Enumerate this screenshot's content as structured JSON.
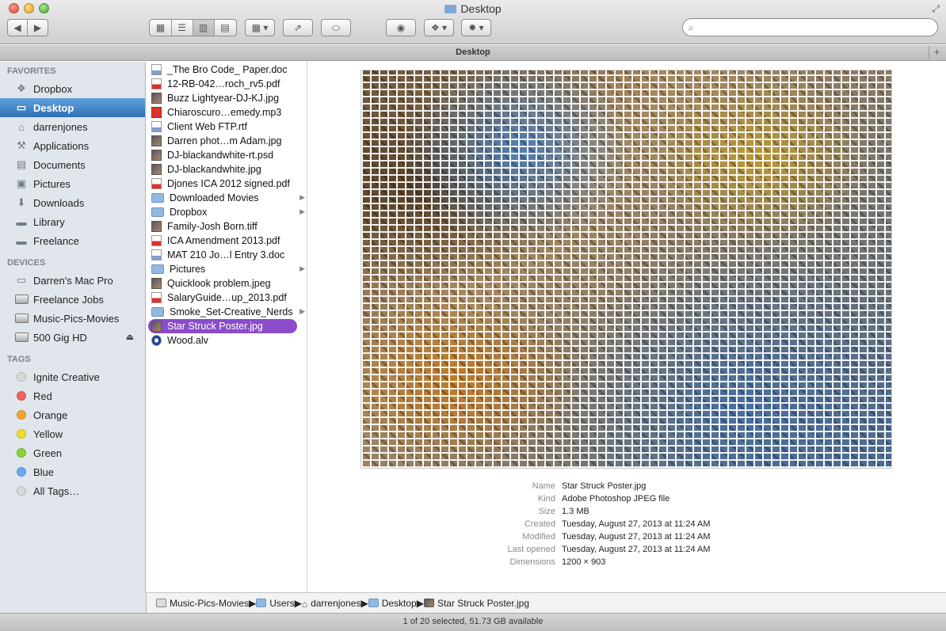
{
  "window": {
    "title": "Desktop"
  },
  "tabbar": {
    "title": "Desktop"
  },
  "search": {
    "placeholder": "",
    "value": ""
  },
  "sidebar": {
    "favorites_label": "FAVORITES",
    "favorites": [
      {
        "label": "Dropbox",
        "icon": "dropbox-icon"
      },
      {
        "label": "Desktop",
        "icon": "desktop-icon",
        "selected": true
      },
      {
        "label": "darrenjones",
        "icon": "home-icon"
      },
      {
        "label": "Applications",
        "icon": "applications-icon"
      },
      {
        "label": "Documents",
        "icon": "documents-icon"
      },
      {
        "label": "Pictures",
        "icon": "pictures-icon"
      },
      {
        "label": "Downloads",
        "icon": "downloads-icon"
      },
      {
        "label": "Library",
        "icon": "folder-icon"
      },
      {
        "label": "Freelance",
        "icon": "folder-icon"
      }
    ],
    "devices_label": "DEVICES",
    "devices": [
      {
        "label": "Darren's Mac Pro",
        "icon": "computer-icon"
      },
      {
        "label": "Freelance Jobs",
        "icon": "disk-icon"
      },
      {
        "label": "Music-Pics-Movies",
        "icon": "disk-icon"
      },
      {
        "label": "500 Gig HD",
        "icon": "disk-icon",
        "eject": true
      }
    ],
    "tags_label": "TAGS",
    "tags": [
      {
        "label": "Ignite Creative",
        "color": "#d9d9d9"
      },
      {
        "label": "Red",
        "color": "#f0625a"
      },
      {
        "label": "Orange",
        "color": "#f7a533"
      },
      {
        "label": "Yellow",
        "color": "#f2dc28"
      },
      {
        "label": "Green",
        "color": "#8cd03a"
      },
      {
        "label": "Blue",
        "color": "#6aa9f0"
      },
      {
        "label": "All Tags…",
        "color": "#d9d9d9"
      }
    ]
  },
  "files": [
    {
      "name": "_The Bro Code_ Paper.doc",
      "kind": "doc"
    },
    {
      "name": "12-RB-042…roch_rv5.pdf",
      "kind": "pdf"
    },
    {
      "name": "Buzz Lightyear-DJ-KJ.jpg",
      "kind": "img"
    },
    {
      "name": "Chiaroscuro…emedy.mp3",
      "kind": "mp3"
    },
    {
      "name": "Client Web FTP.rtf",
      "kind": "doc"
    },
    {
      "name": "Darren phot…m Adam.jpg",
      "kind": "img"
    },
    {
      "name": "DJ-blackandwhite-rt.psd",
      "kind": "img"
    },
    {
      "name": "DJ-blackandwhite.jpg",
      "kind": "img"
    },
    {
      "name": "Djones ICA 2012 signed.pdf",
      "kind": "pdf"
    },
    {
      "name": "Downloaded Movies",
      "kind": "folder",
      "arrow": true
    },
    {
      "name": "Dropbox",
      "kind": "folder",
      "arrow": true
    },
    {
      "name": "Family-Josh Born.tiff",
      "kind": "img"
    },
    {
      "name": "ICA Amendment 2013.pdf",
      "kind": "pdf"
    },
    {
      "name": "MAT 210 Jo…l Entry 3.doc",
      "kind": "doc"
    },
    {
      "name": "Pictures",
      "kind": "folder",
      "arrow": true
    },
    {
      "name": "Quicklook problem.jpeg",
      "kind": "img"
    },
    {
      "name": "SalaryGuide…up_2013.pdf",
      "kind": "pdf"
    },
    {
      "name": "Smoke_Set-Creative_Nerds",
      "kind": "folder",
      "arrow": true
    },
    {
      "name": "Star Struck Poster.jpg",
      "kind": "img",
      "selected": true
    },
    {
      "name": "Wood.alv",
      "kind": "alv"
    }
  ],
  "preview": {
    "info": [
      {
        "k": "Name",
        "v": "Star Struck Poster.jpg"
      },
      {
        "k": "Kind",
        "v": "Adobe Photoshop JPEG file"
      },
      {
        "k": "Size",
        "v": "1.3 MB"
      },
      {
        "k": "Created",
        "v": "Tuesday, August 27, 2013 at 11:24 AM"
      },
      {
        "k": "Modified",
        "v": "Tuesday, August 27, 2013 at 11:24 AM"
      },
      {
        "k": "Last opened",
        "v": "Tuesday, August 27, 2013 at 11:24 AM"
      },
      {
        "k": "Dimensions",
        "v": "1200 × 903"
      }
    ]
  },
  "pathbar": [
    {
      "label": "Music-Pics-Movies",
      "icon": "disk-icon"
    },
    {
      "label": "Users",
      "icon": "folder-icon"
    },
    {
      "label": "darrenjones",
      "icon": "home-icon"
    },
    {
      "label": "Desktop",
      "icon": "folder-icon"
    },
    {
      "label": "Star Struck Poster.jpg",
      "icon": "image-file-icon"
    }
  ],
  "status": {
    "text": "1 of 20 selected, 51.73 GB available"
  }
}
